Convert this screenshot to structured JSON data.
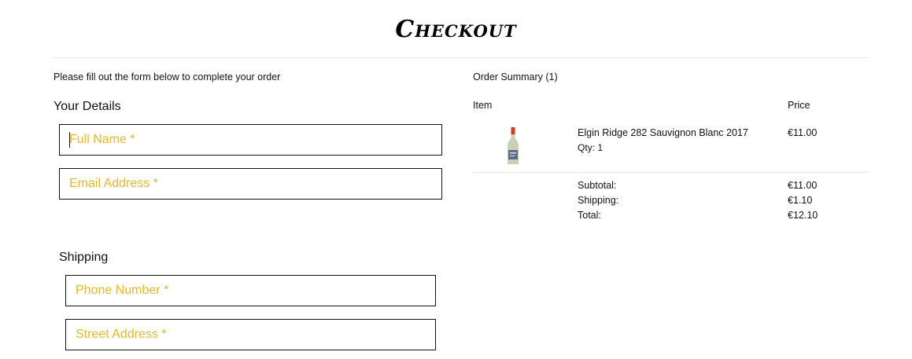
{
  "page": {
    "title": "Checkout",
    "intro": "Please fill out the form below to complete your order"
  },
  "details": {
    "heading": "Your Details",
    "full_name_placeholder": "Full Name *",
    "email_placeholder": "Email Address *"
  },
  "shipping": {
    "heading": "Shipping",
    "phone_placeholder": "Phone Number *",
    "street_placeholder": "Street Address *"
  },
  "summary": {
    "title": "Order Summary (1)",
    "col_item": "Item",
    "col_price": "Price",
    "items": [
      {
        "name": "Elgin Ridge 282 Sauvignon Blanc 2017",
        "qty": "Qty: 1",
        "price": "€11.00"
      }
    ],
    "subtotal_label": "Subtotal:",
    "subtotal_value": "€11.00",
    "shipping_label": "Shipping:",
    "shipping_value": "€1.10",
    "total_label": "Total:",
    "total_value": "€12.10"
  },
  "colors": {
    "placeholder": "#e0b92c",
    "border": "#111111",
    "divider": "#e6e6e6"
  }
}
